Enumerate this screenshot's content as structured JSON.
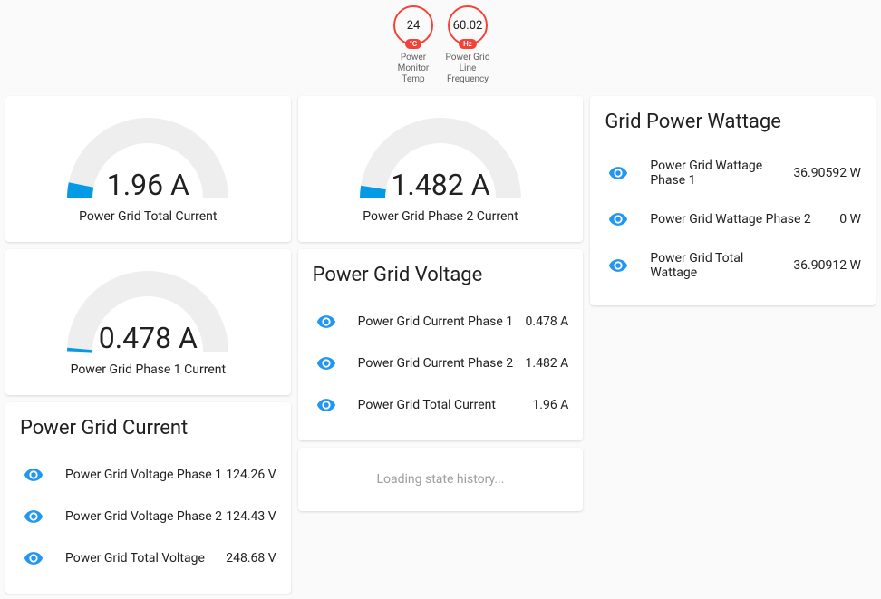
{
  "badges": [
    {
      "value": "24",
      "unit": "°C",
      "label": "Power\nMonitor\nTemp"
    },
    {
      "value": "60.02",
      "unit": "Hz",
      "label": "Power Grid\nLine\nFrequency"
    }
  ],
  "gauges": {
    "total_current": {
      "value": "1.96 A",
      "label": "Power Grid Total Current"
    },
    "phase2_current": {
      "value": "1.482 A",
      "label": "Power Grid Phase 2 Current"
    },
    "phase1_current": {
      "value": "0.478 A",
      "label": "Power Grid Phase 1 Current"
    }
  },
  "current_card": {
    "title": "Power Grid Current",
    "rows": [
      {
        "label": "Power Grid Voltage Phase 1",
        "value": "124.26 V"
      },
      {
        "label": "Power Grid Voltage Phase 2",
        "value": "124.43 V"
      },
      {
        "label": "Power Grid Total Voltage",
        "value": "248.68 V"
      }
    ]
  },
  "voltage_card": {
    "title": "Power Grid Voltage",
    "rows": [
      {
        "label": "Power Grid Current Phase 1",
        "value": "0.478 A"
      },
      {
        "label": "Power Grid Current Phase 2",
        "value": "1.482 A"
      },
      {
        "label": "Power Grid Total Current",
        "value": "1.96 A"
      }
    ]
  },
  "wattage_card": {
    "title": "Grid Power Wattage",
    "rows": [
      {
        "label": "Power Grid Wattage Phase 1",
        "value": "36.90592 W"
      },
      {
        "label": "Power Grid Wattage Phase 2",
        "value": "0 W"
      },
      {
        "label": "Power Grid Total Wattage",
        "value": "36.90912 W"
      }
    ]
  },
  "loading": "Loading state history..."
}
